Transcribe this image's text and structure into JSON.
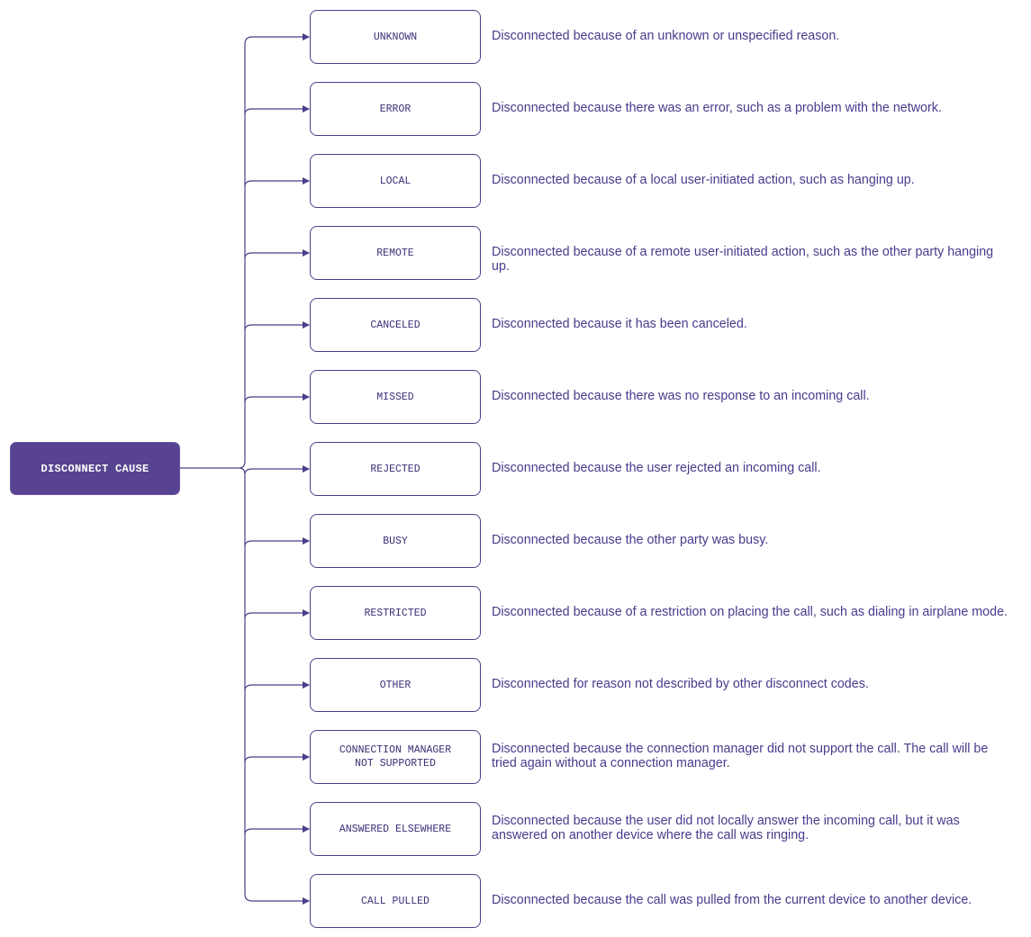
{
  "diagram": {
    "root": {
      "label": "DISCONNECT CAUSE"
    },
    "colors": {
      "accent": "#57438f",
      "line": "#4d3c8a",
      "text": "#4a3a8c"
    },
    "causes": [
      {
        "code": "UNKNOWN",
        "description": "Disconnected because of an unknown or unspecified reason."
      },
      {
        "code": "ERROR",
        "description": "Disconnected because there was an error, such as a problem with the network."
      },
      {
        "code": "LOCAL",
        "description": "Disconnected because of a local user-initiated action, such as hanging up."
      },
      {
        "code": "REMOTE",
        "description": "Disconnected because of a remote user-initiated action, such as the other party hanging up."
      },
      {
        "code": "CANCELED",
        "description": "Disconnected because it has been canceled."
      },
      {
        "code": "MISSED",
        "description": "Disconnected because there was no response to an incoming call."
      },
      {
        "code": "REJECTED",
        "description": "Disconnected because the user rejected an incoming call."
      },
      {
        "code": "BUSY",
        "description": "Disconnected because the other party was busy."
      },
      {
        "code": "RESTRICTED",
        "description": "Disconnected because of a restriction on placing the call, such as dialing in airplane mode."
      },
      {
        "code": "OTHER",
        "description": "Disconnected for reason not described by other disconnect codes."
      },
      {
        "code": "CONNECTION MANAGER\nNOT SUPPORTED",
        "description": "Disconnected because the connection manager did not support the call. The call will be tried again without a connection manager."
      },
      {
        "code": "ANSWERED ELSEWHERE",
        "description": "Disconnected because the user did not locally answer the incoming call, but it was answered on another device where the call was ringing."
      },
      {
        "code": "CALL PULLED",
        "description": "Disconnected because the call was pulled from the current device to another device."
      }
    ]
  }
}
